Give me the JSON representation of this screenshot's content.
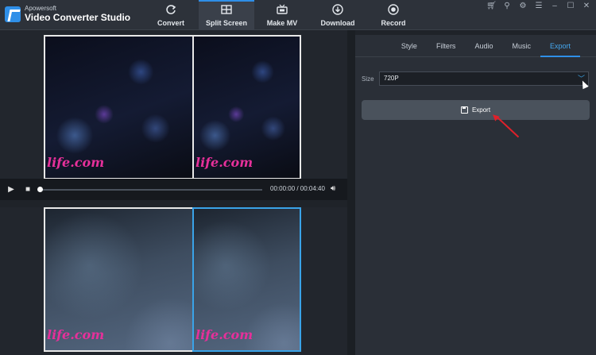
{
  "app": {
    "brand_small": "Apowersoft",
    "brand_title": "Video Converter Studio"
  },
  "nav": {
    "tabs": [
      {
        "label": "Convert",
        "icon": "refresh-icon"
      },
      {
        "label": "Split Screen",
        "icon": "split-screen-icon",
        "active": true
      },
      {
        "label": "Make MV",
        "icon": "tv-icon"
      },
      {
        "label": "Download",
        "icon": "download-icon"
      },
      {
        "label": "Record",
        "icon": "record-icon"
      }
    ]
  },
  "window_controls": [
    "cart-icon",
    "user-icon",
    "settings-icon",
    "menu-icon",
    "minimize-icon",
    "maximize-icon",
    "close-icon"
  ],
  "player": {
    "time": "00:00:00 / 00:04:40",
    "progress": 0
  },
  "watermark_text": "life.com",
  "panel": {
    "tabs": [
      "Style",
      "Filters",
      "Audio",
      "Music",
      "Export"
    ],
    "active_tab": "Export",
    "size_label": "Size",
    "size_value": "720P",
    "export_label": "Export"
  },
  "colors": {
    "accent": "#2f8fe8",
    "annotation_arrow": "#e0202a"
  }
}
